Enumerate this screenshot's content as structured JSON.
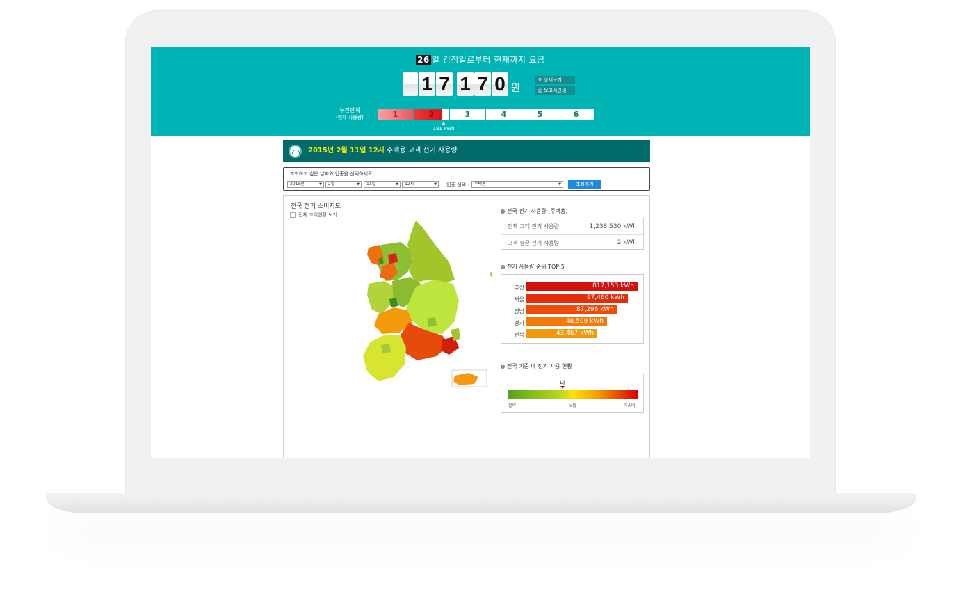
{
  "header": {
    "day": "26",
    "title_rest": "일 검침일로부터 현재까지 요금",
    "digits": [
      "1",
      "7",
      "1",
      "7",
      "0"
    ],
    "won": "원",
    "detail_button": "상세보기",
    "print_button": "보고서인쇄",
    "tier_label": "누진단계",
    "tier_sublabel": "(현재 사용량)",
    "tiers": [
      "1",
      "2",
      "3",
      "4",
      "5",
      "6"
    ],
    "current_usage": "181 kWh"
  },
  "content_bar": {
    "date": "2015년 2월 11일 12시",
    "title": " 주택용 고객 전기 사용량"
  },
  "filter": {
    "hint": "조회하고 싶은 날짜와 업종을 선택하세요.",
    "year": "2015년",
    "month": "2월",
    "day": "11일",
    "hour": "12시",
    "type_label": "업종 선택 :",
    "type_value": "주택용",
    "search_button": "조회하기"
  },
  "map": {
    "title": "전국 전기 소비지도",
    "checkbox_label": "전체 고객현황 보기"
  },
  "usage": {
    "title": "전국 전기 사용량 (주택용)",
    "rows": [
      {
        "label": "전체 고객 전기 사용량",
        "value": "1,238,530 kWh"
      },
      {
        "label": "고객 평균 전기 사용량",
        "value": "2 kWh"
      }
    ]
  },
  "ranking": {
    "title": "전기 사용량 순위 TOP 5",
    "items": [
      {
        "region": "부산",
        "value_label": "817,153 kWh",
        "color": "#d2130c"
      },
      {
        "region": "서울",
        "value_label": "97,460 kWh",
        "color": "#e42e0a"
      },
      {
        "region": "경남",
        "value_label": "87,296 kWh",
        "color": "#ef4a08"
      },
      {
        "region": "경기",
        "value_label": "48,509 kWh",
        "color": "#f17a0a"
      },
      {
        "region": "전북",
        "value_label": "43,467 kWh",
        "color": "#f39a0c"
      }
    ]
  },
  "gauge": {
    "title": "전국 기준 내 전기 사용 현황",
    "me_label": "나",
    "level": 0.42,
    "legend": [
      "절약",
      "보통",
      "과소비"
    ]
  },
  "colors": {
    "teal": "#00b3b5",
    "dark_teal": "#006b68",
    "button_blue": "#1e8be3"
  }
}
